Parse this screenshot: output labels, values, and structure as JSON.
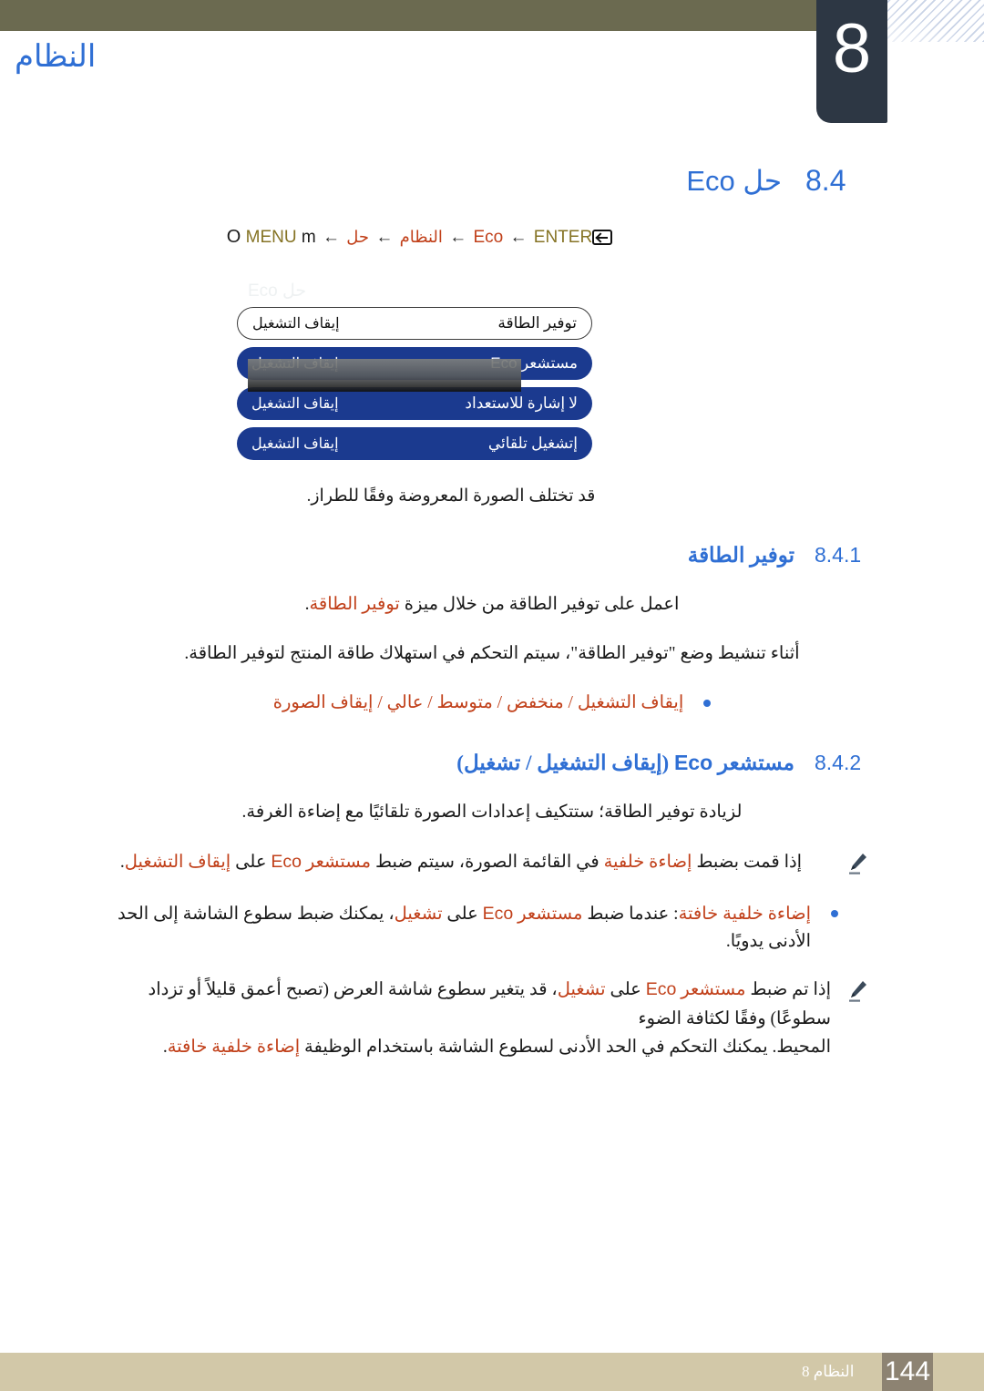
{
  "chapter": {
    "number": "8",
    "title": "النظام"
  },
  "section": {
    "number": "8.4",
    "title_ar": "حل",
    "title_latin": "Eco"
  },
  "breadcrumb": {
    "key_o": "O",
    "key_menu": "MENU",
    "key_m": "m",
    "arrow": "←",
    "step_system": "النظام",
    "step_hal": "حل",
    "step_eco": "Eco",
    "step_enter": "ENTER",
    "enter_icon": "enter-key-icon"
  },
  "osd": {
    "ghost_title": "حل Eco",
    "rows": [
      {
        "name_ar": "توفير الطاقة",
        "name_latin": "",
        "value": "إيقاف التشغيل",
        "selected": false
      },
      {
        "name_ar": "مستشعر",
        "name_latin": "Eco",
        "value": "إيقاف التشغيل",
        "selected": true
      },
      {
        "name_ar": "لا إشارة للاستعداد",
        "name_latin": "",
        "value": "إيقاف التشغيل",
        "selected": true
      },
      {
        "name_ar": "إتشغيل تلقائي",
        "name_latin": "",
        "value": "إيقاف التشغيل",
        "selected": true
      }
    ],
    "caption": "قد تختلف الصورة المعروضة وفقًا للطراز."
  },
  "subsection_841": {
    "number": "8.4.1",
    "title": "توفير الطاقة",
    "para1_a": "اعمل على توفير الطاقة من خلال ميزة ",
    "para1_highlight": "توفير الطاقة",
    "para1_b": ".",
    "para2": "أثناء تنشيط وضع \"توفير الطاقة\"، سيتم التحكم في استهلاك طاقة المنتج لتوفير الطاقة.",
    "options": "إيقاف التشغيل / منخفض / متوسط / عالي / إيقاف الصورة"
  },
  "subsection_842": {
    "number": "8.4.2",
    "title_ar_1": "مستشعر",
    "title_latin": "Eco",
    "title_ar_2": "(إيقاف التشغيل / تشغيل)",
    "para1": "لزيادة توفير الطاقة؛ ستتكيف إعدادات الصورة تلقائيًا مع إضاءة الغرفة.",
    "note1_a": "إذا قمت بضبط ",
    "note1_h1": "إضاءة خلفية",
    "note1_b": " في القائمة الصورة، سيتم ضبط ",
    "note1_h2": "مستشعر",
    "note1_latin": "Eco",
    "note1_c": " على ",
    "note1_h3": "إيقاف التشغيل",
    "note1_d": ".",
    "bullet1_h1": "إضاءة خلفية خافتة",
    "bullet1_a": ": عندما ضبط ",
    "bullet1_h2": "مستشعر",
    "bullet1_latin": "Eco",
    "bullet1_b": " على ",
    "bullet1_h3": "تشغيل",
    "bullet1_c": "، يمكنك ضبط سطوع الشاشة إلى الحد الأدنى يدويًا.",
    "note2_a": "إذا تم ضبط ",
    "note2_h1": "مستشعر",
    "note2_latin": "Eco",
    "note2_b": " على ",
    "note2_h2": "تشغيل",
    "note2_c": "، قد يتغير سطوع شاشة العرض (تصبح أعمق قليلاً أو تزداد سطوعًا) وفقًا لكثافة الضوء",
    "note2_line2_a": "المحيط. يمكنك التحكم في الحد الأدنى لسطوع الشاشة باستخدام الوظيفة ",
    "note2_line2_h": "إضاءة خلفية خافتة",
    "note2_line2_b": "."
  },
  "footer": {
    "chapter_label": "النظام 8",
    "page_number": "144"
  },
  "colors": {
    "accent_blue": "#2f6fd4",
    "accent_red": "#c1401a",
    "olive": "#6b6a50",
    "dark_tab": "#2d3744",
    "osd_blue": "#1b3a8f",
    "footer_tan": "#d2c8a8",
    "footer_box": "#8d8372",
    "crumb_olive": "#857324"
  }
}
